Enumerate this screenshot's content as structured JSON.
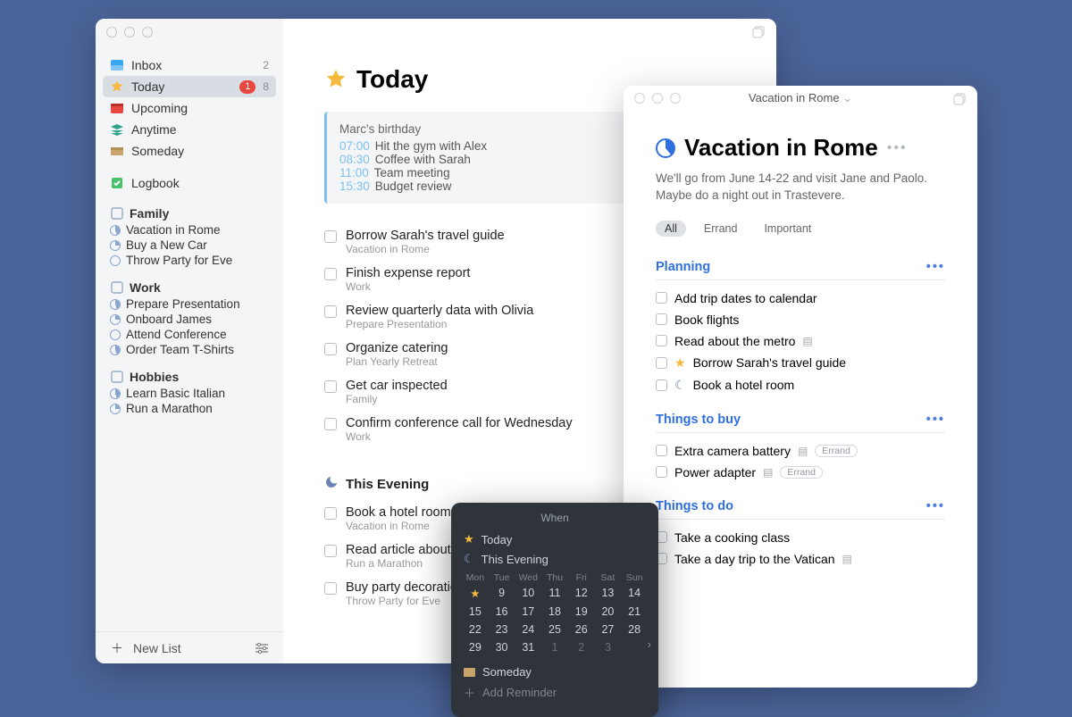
{
  "colors": {
    "accent_blue": "#2F6FE0",
    "star_yellow": "#F6B93B",
    "bg": "#4B6499"
  },
  "main_window": {
    "sidebar": {
      "smartlists": {
        "inbox": {
          "label": "Inbox",
          "count": "2"
        },
        "today": {
          "label": "Today",
          "badge": "1",
          "count": "8"
        },
        "upcoming": {
          "label": "Upcoming"
        },
        "anytime": {
          "label": "Anytime"
        },
        "someday": {
          "label": "Someday"
        },
        "logbook": {
          "label": "Logbook"
        }
      },
      "areas": [
        {
          "name": "Family",
          "projects": [
            "Vacation in Rome",
            "Buy a New Car",
            "Throw Party for Eve"
          ]
        },
        {
          "name": "Work",
          "projects": [
            "Prepare Presentation",
            "Onboard James",
            "Attend Conference",
            "Order Team T-Shirts"
          ]
        },
        {
          "name": "Hobbies",
          "projects": [
            "Learn Basic Italian",
            "Run a Marathon"
          ]
        }
      ],
      "footer": {
        "new_list": "New List"
      }
    },
    "content": {
      "title": "Today",
      "agenda": {
        "birthday": "Marc's birthday",
        "rows": [
          {
            "time": "07:00",
            "text": "Hit the gym with Alex"
          },
          {
            "time": "08:30",
            "text": "Coffee with Sarah"
          },
          {
            "time": "11:00",
            "text": "Team meeting"
          },
          {
            "time": "15:30",
            "text": "Budget review"
          }
        ]
      },
      "tasks": [
        {
          "title": "Borrow Sarah's travel guide",
          "project": "Vacation in Rome"
        },
        {
          "title": "Finish expense report",
          "project": "Work"
        },
        {
          "title": "Review quarterly data with Olivia",
          "project": "Prepare Presentation"
        },
        {
          "title": "Organize catering",
          "project": "Plan Yearly Retreat"
        },
        {
          "title": "Get car inspected",
          "project": "Family"
        },
        {
          "title": "Confirm conference call for Wednesday",
          "project": "Work"
        }
      ],
      "evening_header": "This Evening",
      "evening_tasks": [
        {
          "title": "Book a hotel room",
          "project": "Vacation in Rome"
        },
        {
          "title": "Read article about",
          "project": "Run a Marathon"
        },
        {
          "title": "Buy party decoratio",
          "project": "Throw Party for Eve"
        }
      ]
    }
  },
  "popover": {
    "heading": "When",
    "quick": {
      "today": "Today",
      "evening": "This Evening",
      "someday": "Someday",
      "add_reminder": "Add Reminder"
    },
    "day_headers": [
      "Mon",
      "Tue",
      "Wed",
      "Thu",
      "Fri",
      "Sat",
      "Sun"
    ],
    "weeks": [
      [
        "★",
        "9",
        "10",
        "11",
        "12",
        "13",
        "14"
      ],
      [
        "15",
        "16",
        "17",
        "18",
        "19",
        "20",
        "21"
      ],
      [
        "22",
        "23",
        "24",
        "25",
        "26",
        "27",
        "28"
      ],
      [
        "29",
        "30",
        "31",
        "1",
        "2",
        "3",
        ""
      ]
    ]
  },
  "project_window": {
    "title_center": "Vacation in Rome",
    "heading": "Vacation in Rome",
    "notes": "We'll go from June 14-22 and visit Jane and Paolo. Maybe do a night out in Trastevere.",
    "tags": [
      "All",
      "Errand",
      "Important"
    ],
    "sections": [
      {
        "title": "Planning",
        "tasks": [
          {
            "title": "Add trip dates to calendar"
          },
          {
            "title": "Book flights"
          },
          {
            "title": "Read about the metro",
            "file": true
          },
          {
            "title": "Borrow Sarah's travel guide",
            "starred": true
          },
          {
            "title": "Book a hotel room",
            "evening": true
          }
        ]
      },
      {
        "title": "Things to buy",
        "tasks": [
          {
            "title": "Extra camera battery",
            "file": true,
            "tag": "Errand"
          },
          {
            "title": "Power adapter",
            "file": true,
            "tag": "Errand"
          }
        ]
      },
      {
        "title": "Things to do",
        "tasks": [
          {
            "title": "Take a cooking class"
          },
          {
            "title": "Take a day trip to the Vatican",
            "file": true
          }
        ]
      }
    ]
  }
}
